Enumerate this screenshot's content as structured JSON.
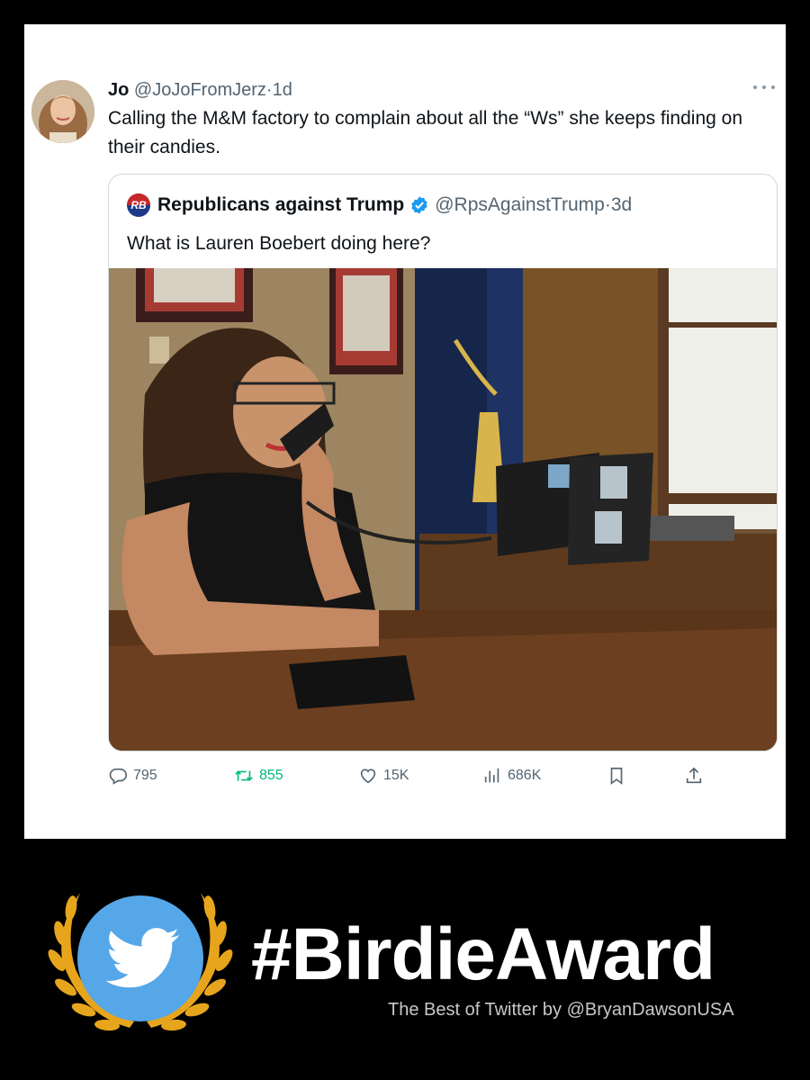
{
  "tweet": {
    "author_name": "Jo",
    "handle": "@JoJoFromJerz",
    "separator": "·",
    "timestamp": "1d",
    "text": "Calling the M&M factory to complain about all the “Ws” she keeps finding on their candies.",
    "icons": {
      "avatar": "user-avatar",
      "more": "more-icon"
    }
  },
  "quoted_tweet": {
    "logo_text": "RB",
    "author_name": "Republicans against Trump",
    "verified_icon": "verified-badge-icon",
    "handle": "@RpsAgainstTrump",
    "separator": "·",
    "timestamp": "3d",
    "text": "What is Lauren Boebert doing here?",
    "image_alt": "office-photo"
  },
  "actions": {
    "reply_count": "795",
    "retweet_count": "855",
    "like_count": "15K",
    "view_count": "686K",
    "icons": [
      "reply-icon",
      "retweet-icon",
      "like-icon",
      "views-icon",
      "bookmark-icon",
      "share-icon"
    ]
  },
  "banner": {
    "title": "#BirdieAward",
    "subtitle": "The Best of Twitter by @BryanDawsonUSA",
    "icons": [
      "laurel-wreath-icon",
      "twitter-bird-icon"
    ]
  },
  "colors": {
    "text_primary": "#0f1419",
    "text_secondary": "#536471",
    "retweet_green": "#00ba7c",
    "verified_blue": "#1d9bf0",
    "twitter_blue": "#56a7e8",
    "laurel_gold": "#e6a51c",
    "border": "#cfd9de"
  }
}
